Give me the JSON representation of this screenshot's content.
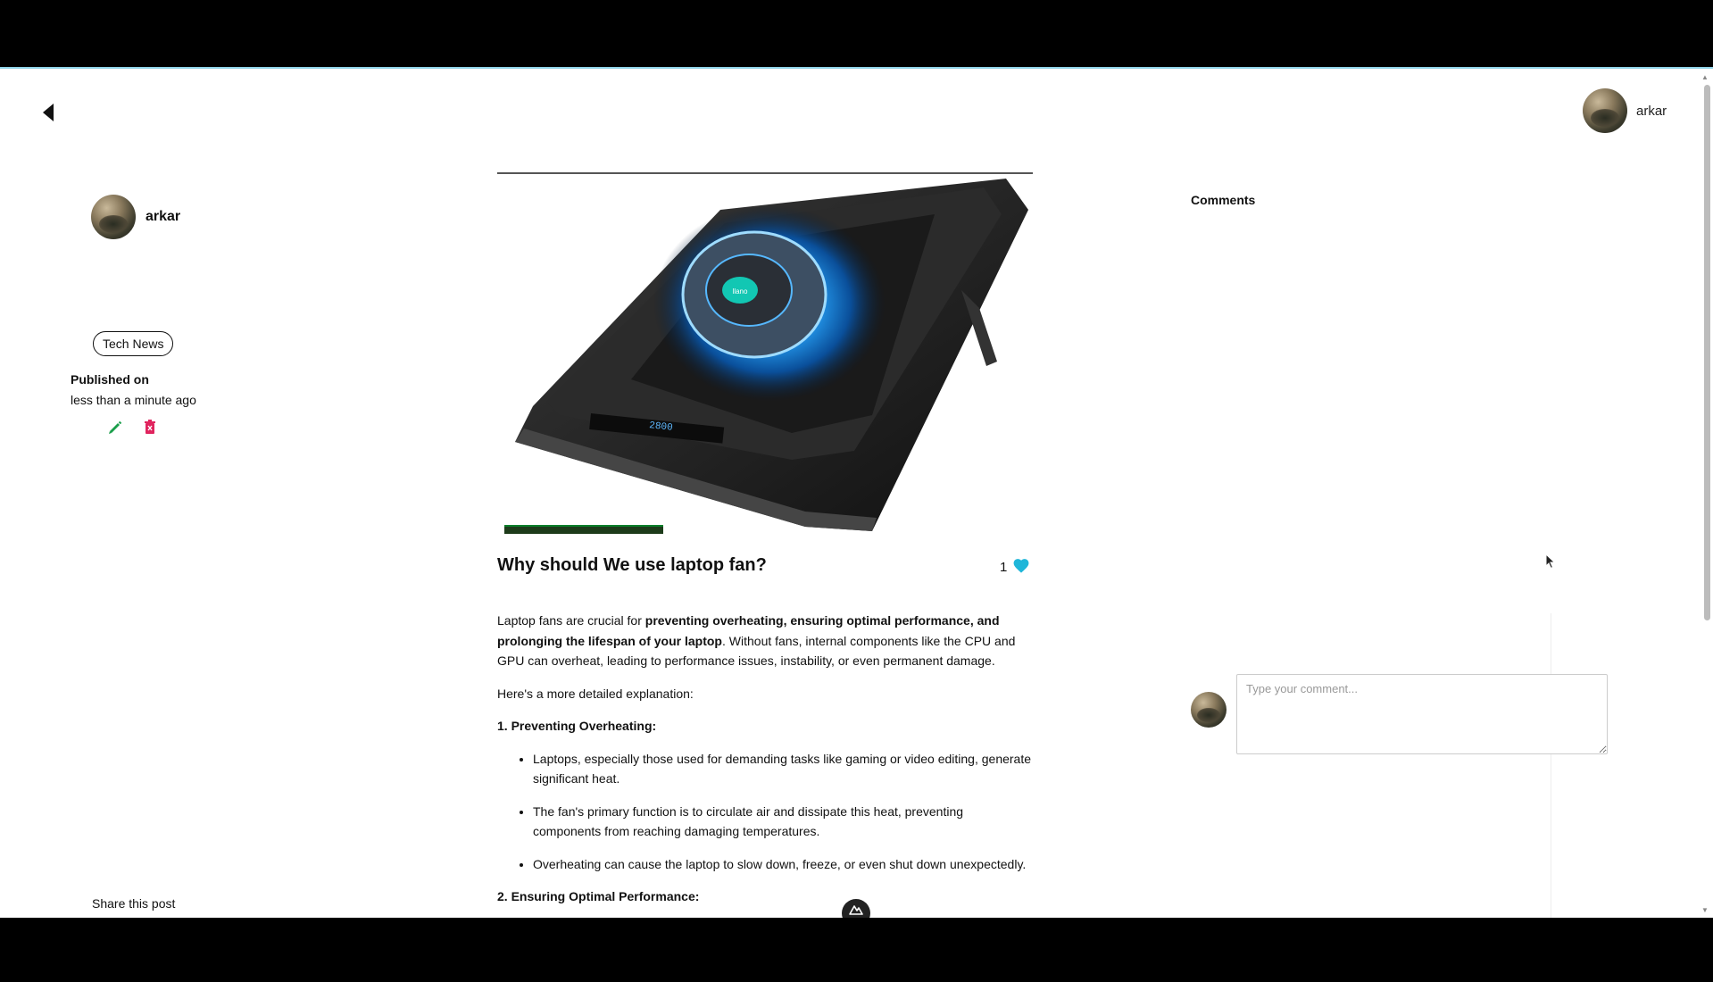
{
  "header": {
    "back_icon": "back-arrow-icon",
    "username": "arkar"
  },
  "author": {
    "name": "arkar",
    "tag": "Tech News",
    "published_label": "Published on",
    "published_time": "less than a minute ago",
    "edit_icon": "pencil-icon",
    "delete_icon": "trash-icon"
  },
  "share": {
    "label": "Share this post",
    "icons": [
      "youtube-icon",
      "facebook-icon",
      "twitter-icon"
    ]
  },
  "post": {
    "title": "Why should We use laptop fan?",
    "like_count": "1",
    "hero_display": "2800",
    "hero_logo": "llano",
    "intro_plain_1": "Laptop fans are crucial for ",
    "intro_bold": "preventing overheating, ensuring optimal performance, and prolonging the lifespan of your laptop",
    "intro_plain_2": ". Without fans, internal components like the CPU and GPU can overheat, leading to performance issues, instability, or even permanent damage.",
    "detail_intro": "Here's a more detailed explanation:",
    "section1_heading": "1. Preventing Overheating:",
    "section1_items": [
      "Laptops, especially those used for demanding tasks like gaming or video editing, generate significant heat.",
      "The fan's primary function is to circulate air and dissipate this heat, preventing components from reaching damaging temperatures.",
      "Overheating can cause the laptop to slow down, freeze, or even shut down unexpectedly."
    ],
    "section2_heading": "2. Ensuring Optimal Performance:"
  },
  "comments": {
    "title": "Comments",
    "placeholder": "Type your comment..."
  },
  "colors": {
    "like_heart": "#1fb6d9",
    "edit_green": "#1a9e4a",
    "delete_red": "#e0245e",
    "top_border": "#8fd3e8"
  }
}
